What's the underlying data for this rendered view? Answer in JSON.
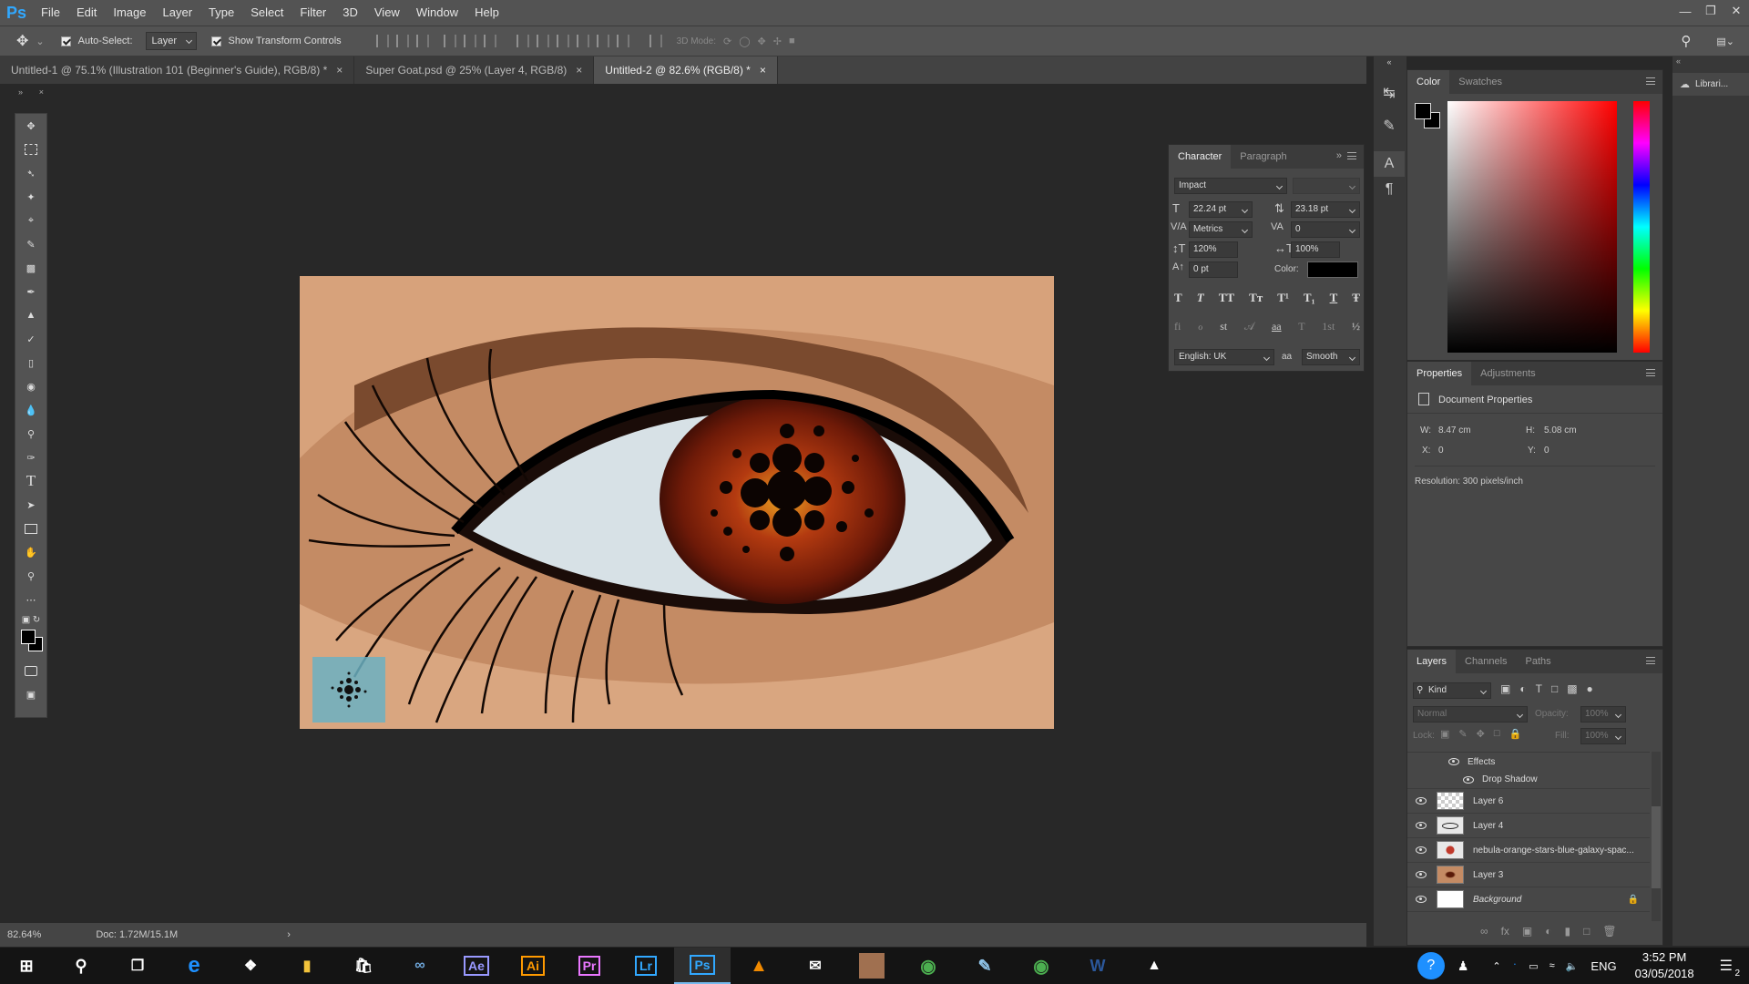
{
  "menubar": {
    "logo": "Ps",
    "items": [
      "File",
      "Edit",
      "Image",
      "Layer",
      "Type",
      "Select",
      "Filter",
      "3D",
      "View",
      "Window",
      "Help"
    ]
  },
  "options": {
    "auto_select_label": "Auto-Select:",
    "auto_select_value": "Layer",
    "transform_label": "Show Transform Controls",
    "mode_3d_label": "3D Mode:"
  },
  "tabs": [
    {
      "label": "Untitled-1 @ 75.1% (Illustration 101 (Beginner's Guide), RGB/8) *",
      "active": false
    },
    {
      "label": "Super Goat.psd @ 25% (Layer 4, RGB/8)",
      "active": false
    },
    {
      "label": "Untitled-2 @ 82.6% (RGB/8) *",
      "active": true
    }
  ],
  "status": {
    "zoom": "82.64%",
    "doc": "Doc: 1.72M/15.1M"
  },
  "character": {
    "tab1": "Character",
    "tab2": "Paragraph",
    "font": "Impact",
    "size": "22.24 pt",
    "leading": "23.18 pt",
    "kerning": "Metrics",
    "tracking": "0",
    "vscale": "120%",
    "hscale": "100%",
    "baseline": "0 pt",
    "color_label": "Color:",
    "language": "English: UK",
    "aa_label": "aa",
    "antialias": "Smooth",
    "style_buttons": [
      "T",
      "T",
      "TT",
      "Tт",
      "T¹",
      "T₁",
      "T",
      "Ŧ"
    ],
    "ot_buttons": [
      "fi",
      "ℴ",
      "st",
      "𝒜",
      "aa",
      "T",
      "1st",
      "½"
    ]
  },
  "color_panel": {
    "tab1": "Color",
    "tab2": "Swatches"
  },
  "properties": {
    "tab1": "Properties",
    "tab2": "Adjustments",
    "title": "Document Properties",
    "w_label": "W:",
    "w": "8.47 cm",
    "h_label": "H:",
    "h": "5.08 cm",
    "x_label": "X:",
    "x": "0",
    "y_label": "Y:",
    "y": "0",
    "resolution": "Resolution: 300 pixels/inch"
  },
  "libraries": {
    "label": "Librari..."
  },
  "layers_panel": {
    "tab1": "Layers",
    "tab2": "Channels",
    "tab3": "Paths",
    "filter": "Kind",
    "blend": "Normal",
    "opacity_label": "Opacity:",
    "opacity": "100%",
    "lock_label": "Lock:",
    "fill_label": "Fill:",
    "fill": "100%",
    "effects": "Effects",
    "drop_shadow": "Drop Shadow",
    "layers": [
      {
        "name": "Layer 6"
      },
      {
        "name": "Layer 4"
      },
      {
        "name": "nebula-orange-stars-blue-galaxy-spac..."
      },
      {
        "name": "Layer 3"
      },
      {
        "name": "Background"
      }
    ]
  },
  "taskbar": {
    "apps": [
      "Ae",
      "Ai",
      "Pr",
      "Lr",
      "Ps"
    ],
    "lang": "ENG",
    "time": "3:52 PM",
    "date": "03/05/2018",
    "notif": "2"
  },
  "colors": {
    "accent": "#31a8ff",
    "panel": "#474747",
    "bg": "#282828"
  }
}
